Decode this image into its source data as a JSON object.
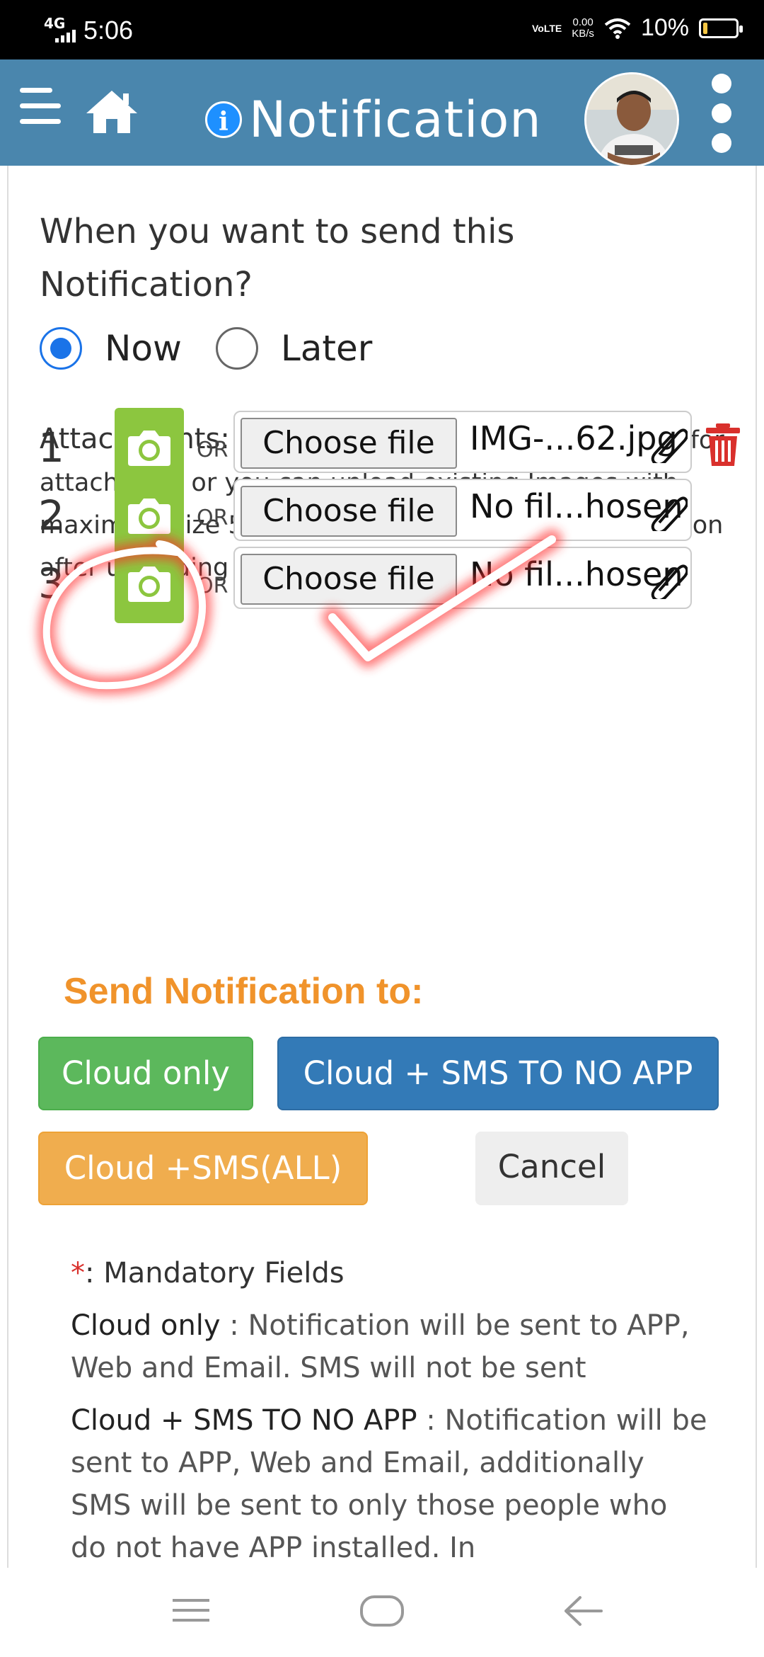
{
  "status_bar": {
    "network": "4G",
    "time": "5:06",
    "volte": "VoLTE",
    "speed_value": "0.00",
    "speed_unit": "KB/s",
    "battery_percent": "10%"
  },
  "header": {
    "title": "Notification",
    "info_icon_glyph": "i",
    "colors": {
      "bar": "#4a86ad",
      "info": "#1e90ff"
    }
  },
  "schedule": {
    "question": "When you want to send this Notification?",
    "options": [
      "Now",
      "Later"
    ],
    "selected": "Now"
  },
  "attachments": {
    "label": "Attachments:",
    "description": "Click on camera icon to take photos for attachment or you can upload existing Images with maximum size 5 MB per Image. Click on Submit button after uploading Attachments",
    "rows": [
      {
        "number": "1",
        "or": "OR",
        "button": "Choose file",
        "file": "IMG-...62.jpg"
      },
      {
        "number": "2",
        "or": "OR",
        "button": "Choose file",
        "file": "No fil...hosen"
      },
      {
        "number": "3",
        "or": "OR",
        "button": "Choose file",
        "file": "No fil...hosen"
      }
    ]
  },
  "send": {
    "title": "Send Notification to:",
    "buttons": {
      "cloud_only": "Cloud only",
      "cloud_sms_no_app": "Cloud + SMS TO NO APP",
      "cloud_sms_all": "Cloud +SMS(ALL)",
      "cancel": "Cancel"
    },
    "colors": {
      "green": "#5cb85c",
      "blue": "#337ab7",
      "orange": "#f0ad4e",
      "title": "#f0932b"
    }
  },
  "notes": {
    "mandatory_star": "*",
    "mandatory_text": ": Mandatory Fields",
    "cloud_only_term": "Cloud only",
    "cloud_only_desc": " : Notification will be sent to APP, Web and Email. SMS will not be sent",
    "cloud_sms_term": "Cloud + SMS TO NO APP",
    "cloud_sms_desc": " : Notification will be sent to APP, Web and Email, additionally SMS will be sent to only those people who do not have APP installed. In"
  }
}
